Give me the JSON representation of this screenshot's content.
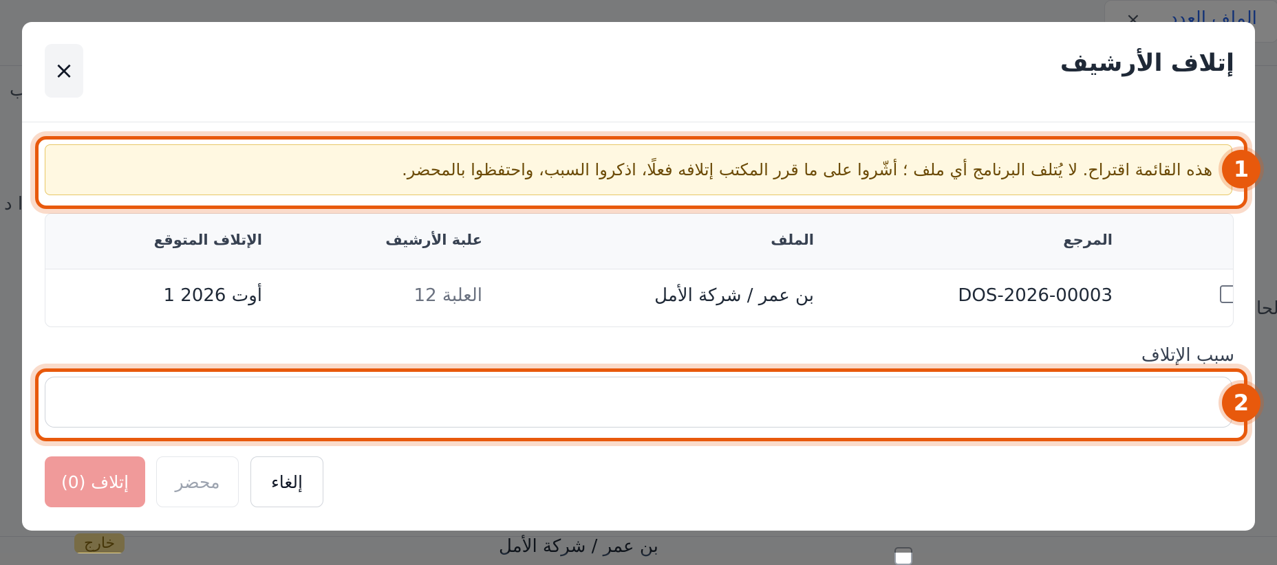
{
  "background": {
    "partial_title": "الملف العدد",
    "row_name": "بن عمر / شركة الأمل",
    "badge": "خارج",
    "side_text_1": "ب",
    "side_text_2": "ا د",
    "side_text_3": "لحا"
  },
  "modal": {
    "title": "إتلاف الأرشيف",
    "close_label": "×",
    "notice": "هذه القائمة اقتراح. لا يُتلف البرنامج أي ملف ؛ أشّروا على ما قرر المكتب إتلافه فعلًا، اذكروا السبب، واحتفظوا بالمحضر.",
    "table": {
      "headers": {
        "reference": "المرجع",
        "file": "الملف",
        "archive_box": "علبة الأرشيف",
        "expected_destruction": "الإتلاف المتوقع"
      },
      "rows": [
        {
          "checked": false,
          "reference": "DOS-2026-00003",
          "file": "بن عمر / شركة الأمل",
          "archive_box": "العلبة 12",
          "expected_destruction": "أوت 2026 1"
        }
      ]
    },
    "reason": {
      "label": "سبب الإتلاف",
      "value": "",
      "placeholder": ""
    },
    "buttons": {
      "cancel": "إلغاء",
      "record": "محضر",
      "destroy": "إتلاف (0)"
    }
  },
  "annotations": {
    "one": "1",
    "two": "2"
  },
  "colors": {
    "highlight": "#e8590c",
    "notice_bg": "#fff8e1",
    "destroy_button": "#f09a9a"
  }
}
